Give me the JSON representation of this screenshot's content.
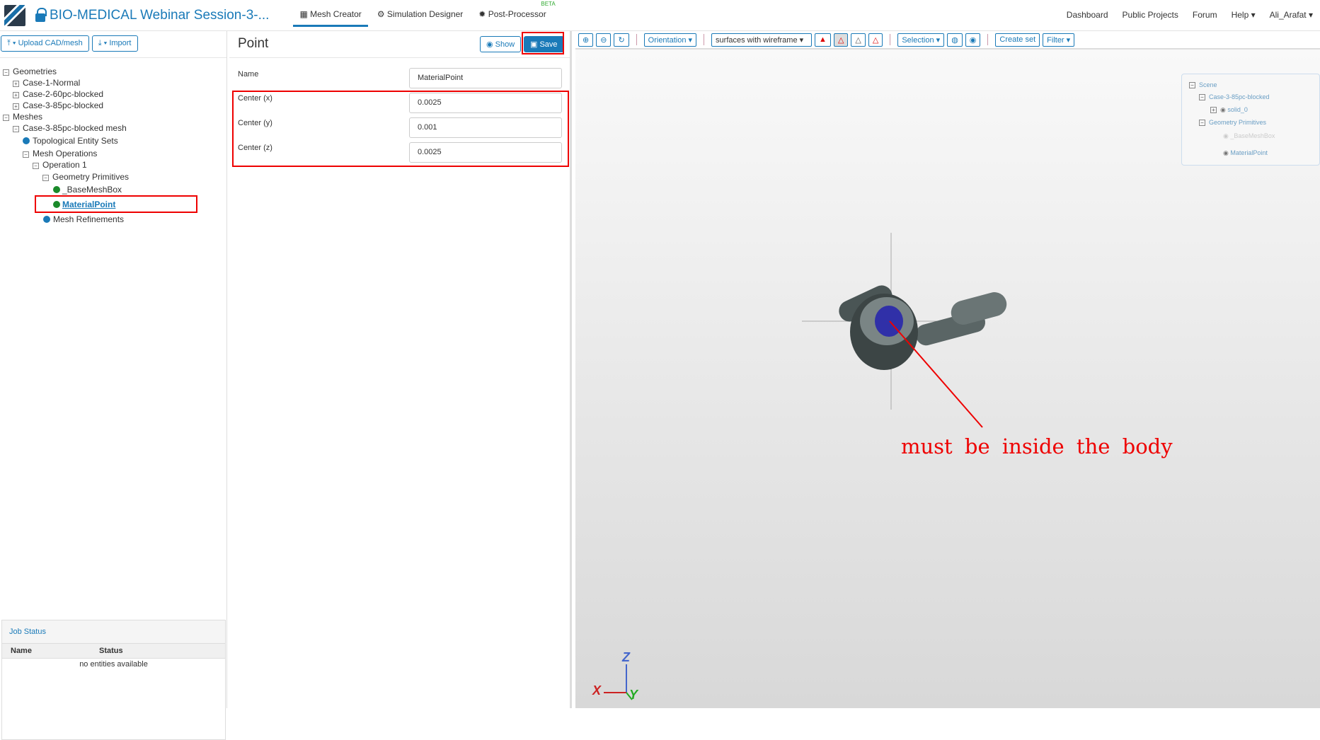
{
  "header": {
    "title": "BIO-MEDICAL Webinar Session-3-...",
    "tabs": [
      {
        "label": "Mesh Creator"
      },
      {
        "label": "Simulation Designer"
      },
      {
        "label": "Post-Processor",
        "badge": "BETA"
      }
    ],
    "right": [
      "Dashboard",
      "Public Projects",
      "Forum",
      "Help"
    ],
    "user": "Ali_Arafat"
  },
  "left": {
    "upload": "Upload CAD/mesh",
    "import": "Import",
    "tree": [
      "Geometries",
      "Case-1-Normal",
      "Case-2-60pc-blocked",
      "Case-3-85pc-blocked",
      "Meshes",
      "Case-3-85pc-blocked mesh",
      "Topological Entity Sets",
      "Mesh Operations",
      "Operation 1",
      "Geometry Primitives",
      "_BaseMeshBox",
      "MaterialPoint",
      "Mesh Refinements"
    ],
    "job": {
      "title": "Job Status",
      "cols": [
        "Name",
        "Status"
      ],
      "empty": "no entities available"
    }
  },
  "form": {
    "title": "Point",
    "show": "Show",
    "save": "Save",
    "fields": [
      {
        "label": "Name",
        "value": "MaterialPoint"
      },
      {
        "label": "Center (x)",
        "value": "0.0025"
      },
      {
        "label": "Center (y)",
        "value": "0.001"
      },
      {
        "label": "Center (z)",
        "value": "0.0025"
      }
    ]
  },
  "viewer": {
    "orientation": "Orientation",
    "render_mode": "surfaces with wireframe",
    "selection": "Selection",
    "create_set": "Create set",
    "filter": "Filter",
    "scene": [
      "Scene",
      "Case-3-85pc-blocked",
      "solid_0",
      "Geometry Primitives",
      "_BaseMeshBox",
      "MaterialPoint"
    ],
    "annotation": "must be inside the body",
    "axes": {
      "x": "X",
      "y": "Y",
      "z": "Z"
    }
  }
}
